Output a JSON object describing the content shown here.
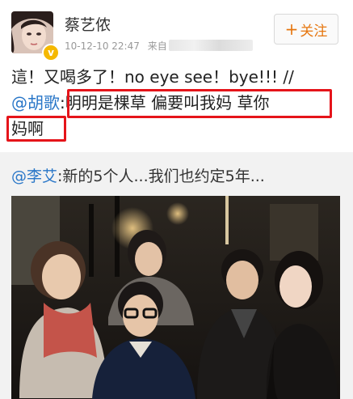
{
  "post": {
    "author_name": "蔡艺侬",
    "timestamp": "10-12-10 22:47",
    "source_prefix": "来自",
    "follow_label": "关注",
    "follow_icon": "plus-icon",
    "verified_badge_icon": "verified-v-icon",
    "line1": "這！又喝多了！no eye see！bye!!! //",
    "line2_mention": "@胡歌",
    "line2_text": ":明明是棵草 偏要叫我妈 草你",
    "line3_text": "妈啊"
  },
  "repost": {
    "mention": "@李艾",
    "text": ":新的5个人...我们也约定5年..."
  },
  "colors": {
    "mention": "#2a77c8",
    "follow": "#e6760f",
    "highlight": "#e5141a",
    "repost_background": "#f2f2f2"
  }
}
